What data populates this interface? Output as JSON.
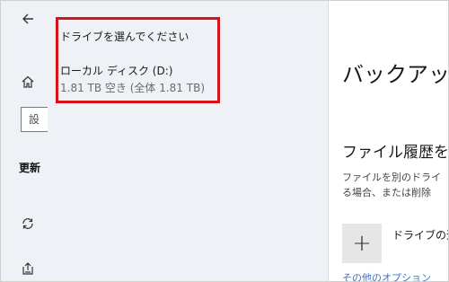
{
  "nav": {
    "back_icon": "arrow-left-icon",
    "home_icon": "home-icon",
    "search_partial": "設",
    "section_label_partial": "更新",
    "sync_icon": "sync-icon",
    "backup_icon": "backup-icon"
  },
  "flyout": {
    "title": "ドライブを選んでください",
    "drives": [
      {
        "name": "ローカル ディスク (D:)",
        "space": "1.81 TB 空き (全体 1.81 TB)"
      }
    ],
    "highlight_color": "#d6121b"
  },
  "main": {
    "page_title": "バックアップ",
    "section_title": "ファイル履歴を",
    "description_line1": "ファイルを別のドライ",
    "description_line2": "る場合、または削除",
    "add_drive_label": "ドライブの追",
    "add_drive_icon": "plus-icon",
    "more_link": "その他のオプション"
  }
}
